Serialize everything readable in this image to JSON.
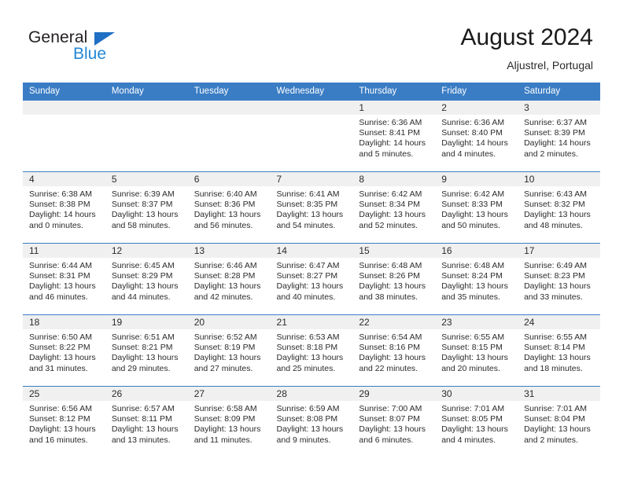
{
  "brand": {
    "name_top": "General",
    "name_bottom": "Blue",
    "triangle_color": "#1f6fc4",
    "blue_color": "#2387d6",
    "dark_color": "#231f20"
  },
  "header": {
    "title": "August 2024",
    "subtitle": "Aljustrel, Portugal"
  },
  "theme": {
    "header_row_bg": "#3a7dc4",
    "day_number_bg": "#f0f0f0",
    "cell_border": "#3a7dc4",
    "text": "#2b2b2b"
  },
  "weekdays": [
    "Sunday",
    "Monday",
    "Tuesday",
    "Wednesday",
    "Thursday",
    "Friday",
    "Saturday"
  ],
  "weeks": [
    [
      {
        "day": "",
        "sunrise": "",
        "sunset": "",
        "daylight_line1": "",
        "daylight_line2": "",
        "empty": true
      },
      {
        "day": "",
        "sunrise": "",
        "sunset": "",
        "daylight_line1": "",
        "daylight_line2": "",
        "empty": true
      },
      {
        "day": "",
        "sunrise": "",
        "sunset": "",
        "daylight_line1": "",
        "daylight_line2": "",
        "empty": true
      },
      {
        "day": "",
        "sunrise": "",
        "sunset": "",
        "daylight_line1": "",
        "daylight_line2": "",
        "empty": true
      },
      {
        "day": "1",
        "sunrise": "Sunrise: 6:36 AM",
        "sunset": "Sunset: 8:41 PM",
        "daylight_line1": "Daylight: 14 hours",
        "daylight_line2": "and 5 minutes."
      },
      {
        "day": "2",
        "sunrise": "Sunrise: 6:36 AM",
        "sunset": "Sunset: 8:40 PM",
        "daylight_line1": "Daylight: 14 hours",
        "daylight_line2": "and 4 minutes."
      },
      {
        "day": "3",
        "sunrise": "Sunrise: 6:37 AM",
        "sunset": "Sunset: 8:39 PM",
        "daylight_line1": "Daylight: 14 hours",
        "daylight_line2": "and 2 minutes."
      }
    ],
    [
      {
        "day": "4",
        "sunrise": "Sunrise: 6:38 AM",
        "sunset": "Sunset: 8:38 PM",
        "daylight_line1": "Daylight: 14 hours",
        "daylight_line2": "and 0 minutes."
      },
      {
        "day": "5",
        "sunrise": "Sunrise: 6:39 AM",
        "sunset": "Sunset: 8:37 PM",
        "daylight_line1": "Daylight: 13 hours",
        "daylight_line2": "and 58 minutes."
      },
      {
        "day": "6",
        "sunrise": "Sunrise: 6:40 AM",
        "sunset": "Sunset: 8:36 PM",
        "daylight_line1": "Daylight: 13 hours",
        "daylight_line2": "and 56 minutes."
      },
      {
        "day": "7",
        "sunrise": "Sunrise: 6:41 AM",
        "sunset": "Sunset: 8:35 PM",
        "daylight_line1": "Daylight: 13 hours",
        "daylight_line2": "and 54 minutes."
      },
      {
        "day": "8",
        "sunrise": "Sunrise: 6:42 AM",
        "sunset": "Sunset: 8:34 PM",
        "daylight_line1": "Daylight: 13 hours",
        "daylight_line2": "and 52 minutes."
      },
      {
        "day": "9",
        "sunrise": "Sunrise: 6:42 AM",
        "sunset": "Sunset: 8:33 PM",
        "daylight_line1": "Daylight: 13 hours",
        "daylight_line2": "and 50 minutes."
      },
      {
        "day": "10",
        "sunrise": "Sunrise: 6:43 AM",
        "sunset": "Sunset: 8:32 PM",
        "daylight_line1": "Daylight: 13 hours",
        "daylight_line2": "and 48 minutes."
      }
    ],
    [
      {
        "day": "11",
        "sunrise": "Sunrise: 6:44 AM",
        "sunset": "Sunset: 8:31 PM",
        "daylight_line1": "Daylight: 13 hours",
        "daylight_line2": "and 46 minutes."
      },
      {
        "day": "12",
        "sunrise": "Sunrise: 6:45 AM",
        "sunset": "Sunset: 8:29 PM",
        "daylight_line1": "Daylight: 13 hours",
        "daylight_line2": "and 44 minutes."
      },
      {
        "day": "13",
        "sunrise": "Sunrise: 6:46 AM",
        "sunset": "Sunset: 8:28 PM",
        "daylight_line1": "Daylight: 13 hours",
        "daylight_line2": "and 42 minutes."
      },
      {
        "day": "14",
        "sunrise": "Sunrise: 6:47 AM",
        "sunset": "Sunset: 8:27 PM",
        "daylight_line1": "Daylight: 13 hours",
        "daylight_line2": "and 40 minutes."
      },
      {
        "day": "15",
        "sunrise": "Sunrise: 6:48 AM",
        "sunset": "Sunset: 8:26 PM",
        "daylight_line1": "Daylight: 13 hours",
        "daylight_line2": "and 38 minutes."
      },
      {
        "day": "16",
        "sunrise": "Sunrise: 6:48 AM",
        "sunset": "Sunset: 8:24 PM",
        "daylight_line1": "Daylight: 13 hours",
        "daylight_line2": "and 35 minutes."
      },
      {
        "day": "17",
        "sunrise": "Sunrise: 6:49 AM",
        "sunset": "Sunset: 8:23 PM",
        "daylight_line1": "Daylight: 13 hours",
        "daylight_line2": "and 33 minutes."
      }
    ],
    [
      {
        "day": "18",
        "sunrise": "Sunrise: 6:50 AM",
        "sunset": "Sunset: 8:22 PM",
        "daylight_line1": "Daylight: 13 hours",
        "daylight_line2": "and 31 minutes."
      },
      {
        "day": "19",
        "sunrise": "Sunrise: 6:51 AM",
        "sunset": "Sunset: 8:21 PM",
        "daylight_line1": "Daylight: 13 hours",
        "daylight_line2": "and 29 minutes."
      },
      {
        "day": "20",
        "sunrise": "Sunrise: 6:52 AM",
        "sunset": "Sunset: 8:19 PM",
        "daylight_line1": "Daylight: 13 hours",
        "daylight_line2": "and 27 minutes."
      },
      {
        "day": "21",
        "sunrise": "Sunrise: 6:53 AM",
        "sunset": "Sunset: 8:18 PM",
        "daylight_line1": "Daylight: 13 hours",
        "daylight_line2": "and 25 minutes."
      },
      {
        "day": "22",
        "sunrise": "Sunrise: 6:54 AM",
        "sunset": "Sunset: 8:16 PM",
        "daylight_line1": "Daylight: 13 hours",
        "daylight_line2": "and 22 minutes."
      },
      {
        "day": "23",
        "sunrise": "Sunrise: 6:55 AM",
        "sunset": "Sunset: 8:15 PM",
        "daylight_line1": "Daylight: 13 hours",
        "daylight_line2": "and 20 minutes."
      },
      {
        "day": "24",
        "sunrise": "Sunrise: 6:55 AM",
        "sunset": "Sunset: 8:14 PM",
        "daylight_line1": "Daylight: 13 hours",
        "daylight_line2": "and 18 minutes."
      }
    ],
    [
      {
        "day": "25",
        "sunrise": "Sunrise: 6:56 AM",
        "sunset": "Sunset: 8:12 PM",
        "daylight_line1": "Daylight: 13 hours",
        "daylight_line2": "and 16 minutes."
      },
      {
        "day": "26",
        "sunrise": "Sunrise: 6:57 AM",
        "sunset": "Sunset: 8:11 PM",
        "daylight_line1": "Daylight: 13 hours",
        "daylight_line2": "and 13 minutes."
      },
      {
        "day": "27",
        "sunrise": "Sunrise: 6:58 AM",
        "sunset": "Sunset: 8:09 PM",
        "daylight_line1": "Daylight: 13 hours",
        "daylight_line2": "and 11 minutes."
      },
      {
        "day": "28",
        "sunrise": "Sunrise: 6:59 AM",
        "sunset": "Sunset: 8:08 PM",
        "daylight_line1": "Daylight: 13 hours",
        "daylight_line2": "and 9 minutes."
      },
      {
        "day": "29",
        "sunrise": "Sunrise: 7:00 AM",
        "sunset": "Sunset: 8:07 PM",
        "daylight_line1": "Daylight: 13 hours",
        "daylight_line2": "and 6 minutes."
      },
      {
        "day": "30",
        "sunrise": "Sunrise: 7:01 AM",
        "sunset": "Sunset: 8:05 PM",
        "daylight_line1": "Daylight: 13 hours",
        "daylight_line2": "and 4 minutes."
      },
      {
        "day": "31",
        "sunrise": "Sunrise: 7:01 AM",
        "sunset": "Sunset: 8:04 PM",
        "daylight_line1": "Daylight: 13 hours",
        "daylight_line2": "and 2 minutes."
      }
    ]
  ]
}
